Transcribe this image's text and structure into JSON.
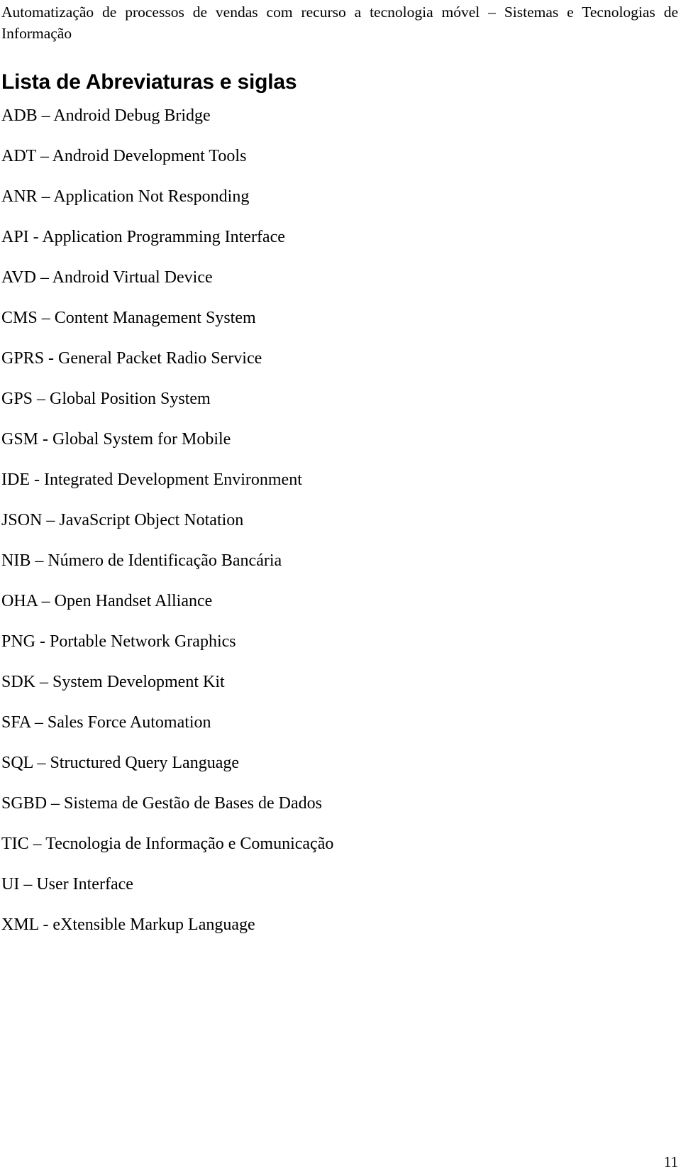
{
  "document": {
    "running_header": {
      "line1": "Automatização de processos de vendas com recurso a tecnologia móvel – Sistemas e Tecnologias de",
      "line2": "Informação"
    },
    "section_heading": "Lista de Abreviaturas e siglas",
    "page_number": "11"
  },
  "abbreviations": [
    {
      "text": "ADB – Android Debug Bridge",
      "acronym": "ADB",
      "separator": "–",
      "definition": "Android Debug Bridge"
    },
    {
      "text": "ADT – Android Development Tools",
      "acronym": "ADT",
      "separator": "–",
      "definition": "Android Development Tools"
    },
    {
      "text": "ANR – Application Not Responding",
      "acronym": "ANR",
      "separator": "–",
      "definition": "Application Not Responding"
    },
    {
      "text": "API - Application Programming Interface",
      "acronym": "API",
      "separator": "-",
      "definition": "Application Programming Interface"
    },
    {
      "text": "AVD – Android Virtual Device",
      "acronym": "AVD",
      "separator": "–",
      "definition": "Android Virtual Device"
    },
    {
      "text": "CMS – Content Management System",
      "acronym": "CMS",
      "separator": "–",
      "definition": "Content Management System"
    },
    {
      "text": "GPRS - General Packet Radio Service",
      "acronym": "GPRS",
      "separator": "-",
      "definition": "General Packet Radio Service"
    },
    {
      "text": "GPS – Global Position System",
      "acronym": "GPS",
      "separator": "–",
      "definition": "Global Position System"
    },
    {
      "text": "GSM - Global System for Mobile",
      "acronym": "GSM",
      "separator": "-",
      "definition": "Global System for Mobile"
    },
    {
      "text": "IDE - Integrated Development Environment",
      "acronym": "IDE",
      "separator": "-",
      "definition": "Integrated Development Environment"
    },
    {
      "text": "JSON – JavaScript Object Notation",
      "acronym": "JSON",
      "separator": "–",
      "definition": "JavaScript Object Notation"
    },
    {
      "text": "NIB – Número de Identificação Bancária",
      "acronym": "NIB",
      "separator": "–",
      "definition": "Número de Identificação Bancária"
    },
    {
      "text": "OHA – Open Handset Alliance",
      "acronym": "OHA",
      "separator": "–",
      "definition": "Open Handset Alliance"
    },
    {
      "text": "PNG - Portable Network Graphics",
      "acronym": "PNG",
      "separator": "-",
      "definition": "Portable Network Graphics"
    },
    {
      "text": "SDK – System Development Kit",
      "acronym": "SDK",
      "separator": "–",
      "definition": "System Development Kit"
    },
    {
      "text": "SFA – Sales Force Automation",
      "acronym": "SFA",
      "separator": "–",
      "definition": "Sales Force Automation"
    },
    {
      "text": "SQL – Structured Query Language",
      "acronym": "SQL",
      "separator": "–",
      "definition": "Structured Query Language"
    },
    {
      "text": "SGBD – Sistema de Gestão de Bases de Dados",
      "acronym": "SGBD",
      "separator": "–",
      "definition": "Sistema de Gestão de Bases de Dados"
    },
    {
      "text": "TIC – Tecnologia de Informação e Comunicação",
      "acronym": "TIC",
      "separator": "–",
      "definition": "Tecnologia de Informação e Comunicação"
    },
    {
      "text": "UI – User Interface",
      "acronym": "UI",
      "separator": "–",
      "definition": "User Interface"
    },
    {
      "text": "XML - eXtensible Markup Language",
      "acronym": "XML",
      "separator": "-",
      "definition": "eXtensible Markup Language"
    }
  ]
}
